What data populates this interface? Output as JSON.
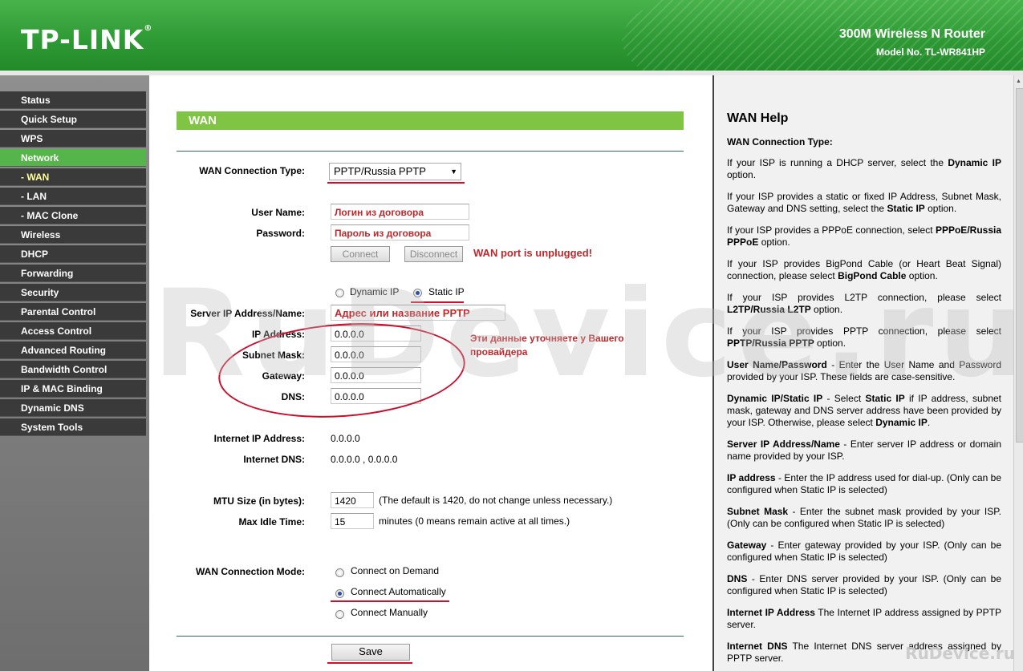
{
  "header": {
    "logo": "TP-LINK",
    "logo_mark": "®",
    "product_name": "300M Wireless N Router",
    "model_no": "Model No. TL-WR841HP"
  },
  "sidebar": {
    "items": [
      {
        "label": "Status"
      },
      {
        "label": "Quick Setup"
      },
      {
        "label": "WPS"
      },
      {
        "label": "Network"
      },
      {
        "label": "- WAN"
      },
      {
        "label": "- LAN"
      },
      {
        "label": "- MAC Clone"
      },
      {
        "label": "Wireless"
      },
      {
        "label": "DHCP"
      },
      {
        "label": "Forwarding"
      },
      {
        "label": "Security"
      },
      {
        "label": "Parental Control"
      },
      {
        "label": "Access Control"
      },
      {
        "label": "Advanced Routing"
      },
      {
        "label": "Bandwidth Control"
      },
      {
        "label": "IP & MAC Binding"
      },
      {
        "label": "Dynamic DNS"
      },
      {
        "label": "System Tools"
      }
    ]
  },
  "main": {
    "section_title": "WAN",
    "wan_type_label": "WAN Connection Type:",
    "wan_type_value": "PPTP/Russia PPTP",
    "user_name_label": "User Name:",
    "user_name_value": "Логин из договора",
    "password_label": "Password:",
    "password_value": "Пароль из договора",
    "connect_label": "Connect",
    "disconnect_label": "Disconnect",
    "unplugged_note": "WAN port is unplugged!",
    "dynamic_ip_label": "Dynamic IP",
    "static_ip_label": "Static IP",
    "server_label": "Server IP Address/Name:",
    "server_value": "Адрес или название PPTP сервера",
    "ip_label": "IP Address:",
    "ip_value": "0.0.0.0",
    "mask_label": "Subnet Mask:",
    "mask_value": "0.0.0.0",
    "gateway_label": "Gateway:",
    "gateway_value": "0.0.0.0",
    "dns_label": "DNS:",
    "dns_value": "0.0.0.0",
    "note_line1": "Эти данные уточняете у Вашего",
    "note_line2": "провайдера",
    "internet_ip_label": "Internet IP Address:",
    "internet_ip_value": "0.0.0.0",
    "internet_dns_label": "Internet DNS:",
    "internet_dns_value": "0.0.0.0 , 0.0.0.0",
    "mtu_label": "MTU Size (in bytes):",
    "mtu_value": "1420",
    "mtu_hint": "(The default is 1420, do not change unless necessary.)",
    "idle_label": "Max Idle Time:",
    "idle_value": "15",
    "idle_hint": "minutes (0 means remain active at all times.)",
    "mode_label": "WAN Connection Mode:",
    "mode_demand": "Connect on Demand",
    "mode_auto": "Connect Automatically",
    "mode_manual": "Connect Manually",
    "save_label": "Save"
  },
  "help": {
    "title": "WAN Help",
    "paragraphs": [
      {
        "bold_lead": "WAN Connection Type:",
        "text": ""
      },
      {
        "text": "If your ISP is running a DHCP server, select the ",
        "bold": "Dynamic IP",
        "tail": " option."
      },
      {
        "text": "If your ISP provides a static or fixed IP Address, Subnet Mask, Gateway and DNS setting, select the ",
        "bold": "Static IP",
        "tail": " option."
      },
      {
        "text": "If your ISP provides a PPPoE connection, select ",
        "bold": "PPPoE/Russia PPPoE",
        "tail": " option."
      },
      {
        "text": "If your ISP provides BigPond Cable (or Heart Beat Signal) connection, please select ",
        "bold": "BigPond Cable",
        "tail": " option."
      },
      {
        "text": "If your ISP provides L2TP connection, please select ",
        "bold": "L2TP/Russia L2TP",
        "tail": " option."
      },
      {
        "text": "If your ISP provides PPTP connection, please select ",
        "bold": "PPTP/Russia PPTP",
        "tail": " option."
      },
      {
        "bold_lead": "User Name/Password",
        "text": " - Enter the User Name and Password provided by your ISP. These fields are case-sensitive."
      },
      {
        "bold_lead": "Dynamic IP/Static IP",
        "text": " - Select ",
        "bold": "Static IP",
        "tail": " if IP address, subnet mask, gateway and DNS server address have been provided by your ISP. Otherwise, please select ",
        "bold2": "Dynamic IP",
        "tail2": "."
      },
      {
        "bold_lead": "Server IP Address/Name",
        "text": " - Enter server IP address or domain name provided by your ISP."
      },
      {
        "bold_lead": "IP address",
        "text": " - Enter the IP address used for dial-up. (Only can be configured when Static IP is selected)"
      },
      {
        "bold_lead": "Subnet Mask",
        "text": " - Enter the subnet mask provided by your ISP. (Only can be configured when Static IP is selected)"
      },
      {
        "bold_lead": "Gateway",
        "text": " - Enter gateway provided by your ISP. (Only can be configured when Static IP is selected)"
      },
      {
        "bold_lead": "DNS",
        "text": " - Enter DNS server provided by your ISP. (Only can be configured when Static IP is selected)"
      },
      {
        "bold_lead": "Internet IP Address",
        "text": " The Internet IP address assigned by PPTP server."
      },
      {
        "bold_lead": "Internet DNS",
        "text": " The Internet DNS server address assigned by PPTP server."
      }
    ]
  },
  "watermark": {
    "big": "RuDevice.ru",
    "corner": "RuDevice.ru"
  }
}
